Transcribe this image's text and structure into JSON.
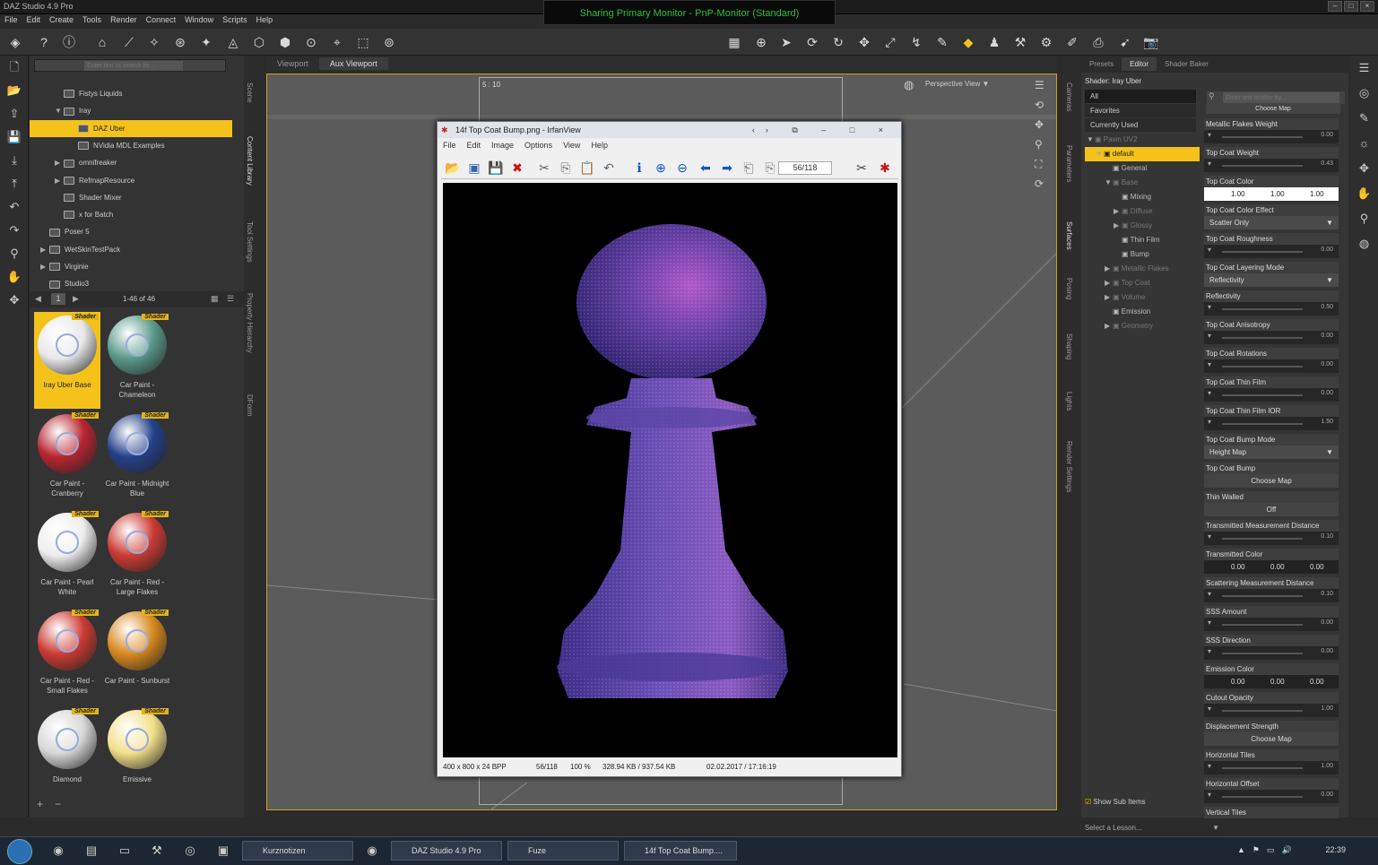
{
  "app": {
    "title": "DAZ Studio 4.9 Pro",
    "banner": "Sharing Primary Monitor - PnP-Monitor (Standard)"
  },
  "menu": [
    "File",
    "Edit",
    "Create",
    "Tools",
    "Render",
    "Connect",
    "Window",
    "Scripts",
    "Help"
  ],
  "content": {
    "search_placeholder": "Enter text to search by...",
    "tree": [
      {
        "label": "Fistys Liquids",
        "indent": 2,
        "arrow": ""
      },
      {
        "label": "Iray",
        "indent": 2,
        "arrow": "▼"
      },
      {
        "label": "DAZ Uber",
        "indent": 3,
        "arrow": "",
        "selected": true
      },
      {
        "label": "NVidia MDL Examples",
        "indent": 3,
        "arrow": ""
      },
      {
        "label": "omnifreaker",
        "indent": 2,
        "arrow": "▶"
      },
      {
        "label": "RefmapResource",
        "indent": 2,
        "arrow": "▶"
      },
      {
        "label": "Shader Mixer",
        "indent": 2,
        "arrow": ""
      },
      {
        "label": "x for Batch",
        "indent": 2,
        "arrow": ""
      },
      {
        "label": "Poser 5",
        "indent": 1,
        "arrow": ""
      },
      {
        "label": "WetSkinTestPack",
        "indent": 1,
        "arrow": "▶"
      },
      {
        "label": "Virginie",
        "indent": 1,
        "arrow": "▶"
      },
      {
        "label": "Studio3",
        "indent": 1,
        "arrow": ""
      }
    ],
    "page": "1",
    "count": "1-46 of 46",
    "badge": "Shader",
    "tiles": [
      {
        "label": "Iray Uber Base",
        "color": "#e8e8e8",
        "selected": true
      },
      {
        "label": "Car Paint - Chameleon",
        "color": "#5a9a8a"
      },
      {
        "label": "Car Paint - Cranberry",
        "color": "#b8252f"
      },
      {
        "label": "Car Paint - Midnight Blue",
        "color": "#23408a"
      },
      {
        "label": "Car Paint - Pearl White",
        "color": "#eeeeee"
      },
      {
        "label": "Car Paint - Red - Large Flakes",
        "color": "#cc3a33"
      },
      {
        "label": "Car Paint - Red - Small Flakes",
        "color": "#cc3a33"
      },
      {
        "label": "Car Paint - Sunburst",
        "color": "#d8881e"
      },
      {
        "label": "Diamond",
        "color": "#d8d8d8"
      },
      {
        "label": "Emissive",
        "color": "#f4e08a"
      }
    ]
  },
  "left_tabs": [
    "Scene",
    "Content Library",
    "Tool Settings",
    "Property Hierarchy",
    "DForm"
  ],
  "viewport": {
    "tabs": [
      "Viewport",
      "Aux Viewport"
    ],
    "ratio": "5 : 10",
    "view": "Perspective View"
  },
  "irfan": {
    "title": "14f Top Coat Bump.png - IrfanView",
    "menu": [
      "File",
      "Edit",
      "Image",
      "Options",
      "View",
      "Help"
    ],
    "counter": "56/118",
    "status": [
      "400 x 800 x 24 BPP",
      "56/118",
      "100 %",
      "328.94 KB / 937.54 KB",
      "02.02.2017 / 17:16:19"
    ]
  },
  "right_tabs": [
    "Cameras",
    "Parameters",
    "Surfaces",
    "Posing",
    "Shaping",
    "Lights",
    "Render Settings"
  ],
  "surfaces": {
    "tabs": [
      "Presets",
      "Editor",
      "Shader Baker"
    ],
    "shader": "Shader: Iray Uber",
    "filters": [
      "All",
      "Favorites",
      "Currently Used"
    ],
    "filter_placeholder": "Enter text to filter by...",
    "tree": [
      {
        "label": "Pawn UV2",
        "indent": 0,
        "arrow": "▼",
        "dim": true
      },
      {
        "label": "default",
        "indent": 1,
        "arrow": "▼",
        "selected": true
      },
      {
        "label": "General",
        "indent": 2,
        "arrow": ""
      },
      {
        "label": "Base",
        "indent": 2,
        "arrow": "▼",
        "dim": true
      },
      {
        "label": "Mixing",
        "indent": 3,
        "arrow": ""
      },
      {
        "label": "Diffuse",
        "indent": 3,
        "arrow": "▶",
        "dim": true
      },
      {
        "label": "Glossy",
        "indent": 3,
        "arrow": "▶",
        "dim": true
      },
      {
        "label": "Thin Film",
        "indent": 3,
        "arrow": ""
      },
      {
        "label": "Bump",
        "indent": 3,
        "arrow": ""
      },
      {
        "label": "Metallic Flakes",
        "indent": 2,
        "arrow": "▶",
        "dim": true
      },
      {
        "label": "Top Coat",
        "indent": 2,
        "arrow": "▶",
        "dim": true
      },
      {
        "label": "Volume",
        "indent": 2,
        "arrow": "▶",
        "dim": true
      },
      {
        "label": "Emission",
        "indent": 2,
        "arrow": ""
      },
      {
        "label": "Geometry",
        "indent": 2,
        "arrow": "▶",
        "dim": true
      }
    ],
    "choose_map": "Choose Map",
    "params": [
      {
        "name": "Metallic Flakes Weight",
        "kind": "slider",
        "value": "0.00"
      },
      {
        "name": "Top Coat Weight",
        "kind": "slider",
        "value": "0.43"
      },
      {
        "name": "Top Coat Color",
        "kind": "rgb",
        "r": "1.00",
        "g": "1.00",
        "b": "1.00"
      },
      {
        "name": "Top Coat Color Effect",
        "kind": "drop",
        "value": "Scatter Only"
      },
      {
        "name": "Top Coat Roughness",
        "kind": "slider",
        "value": "0.00"
      },
      {
        "name": "Top Coat Layering Mode",
        "kind": "drop",
        "value": "Reflectivity"
      },
      {
        "name": "Reflectivity",
        "kind": "slider",
        "value": "0.50"
      },
      {
        "name": "Top Coat Anisotropy",
        "kind": "slider",
        "value": "0.00"
      },
      {
        "name": "Top Coat Rotations",
        "kind": "slider",
        "value": "0.00"
      },
      {
        "name": "Top Coat Thin Film",
        "kind": "slider",
        "value": "0.00"
      },
      {
        "name": "Top Coat Thin Film IOR",
        "kind": "slider",
        "value": "1.50"
      },
      {
        "name": "Top Coat Bump Mode",
        "kind": "drop",
        "value": "Height Map"
      },
      {
        "name": "Top Coat Bump",
        "kind": "btn",
        "value": "Choose Map"
      },
      {
        "name": "Thin Walled",
        "kind": "btn",
        "value": "Off"
      },
      {
        "name": "Transmitted Measurement Distance",
        "kind": "slider",
        "value": "0.10"
      },
      {
        "name": "Transmitted Color",
        "kind": "rgbd",
        "r": "0.00",
        "g": "0.00",
        "b": "0.00"
      },
      {
        "name": "Scattering Measurement Distance",
        "kind": "slider",
        "value": "0.10"
      },
      {
        "name": "SSS Amount",
        "kind": "slider",
        "value": "0.00"
      },
      {
        "name": "SSS Direction",
        "kind": "slider",
        "value": "0.00"
      },
      {
        "name": "Emission Color",
        "kind": "rgbd",
        "r": "0.00",
        "g": "0.00",
        "b": "0.00"
      },
      {
        "name": "Cutout Opacity",
        "kind": "slider",
        "value": "1.00"
      },
      {
        "name": "Displacement Strength",
        "kind": "btn",
        "value": "Choose Map"
      },
      {
        "name": "Horizontal Tiles",
        "kind": "slider",
        "value": "1.00"
      },
      {
        "name": "Horizontal Offset",
        "kind": "slider",
        "value": "0.00"
      },
      {
        "name": "Vertical Tiles",
        "kind": "none",
        "value": ""
      }
    ],
    "show_sub": "Show Sub Items",
    "lesson": "Select a Lesson..."
  },
  "taskbar": {
    "tasks": [
      "Kurznotizen",
      "DAZ Studio 4.9 Pro",
      "Fuze",
      "14f Top Coat Bump...."
    ],
    "time": "22:39"
  }
}
